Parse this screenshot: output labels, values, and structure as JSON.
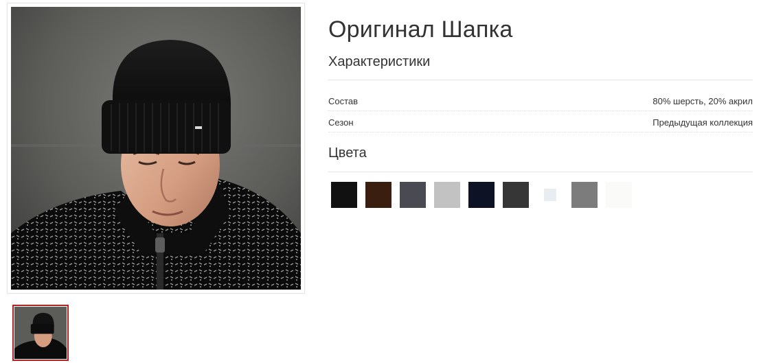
{
  "product": {
    "title": "Оригинал Шапка"
  },
  "characteristics": {
    "heading": "Характеристики",
    "rows": [
      {
        "label": "Состав",
        "value": "80% шерсть, 20% акрил"
      },
      {
        "label": "Сезон",
        "value": "Предыдущая коллекция"
      }
    ]
  },
  "colors": {
    "heading": "Цвета",
    "swatches": [
      {
        "name": "black",
        "color": "#111111"
      },
      {
        "name": "brown",
        "color": "#3a1e10"
      },
      {
        "name": "graphite",
        "color": "#4a4a52"
      },
      {
        "name": "light-gray",
        "color": "#c2c2c2"
      },
      {
        "name": "navy",
        "color": "#0d1224"
      },
      {
        "name": "dark-gray",
        "color": "#363636"
      },
      {
        "name": "white",
        "color": "#e8edf2"
      },
      {
        "name": "gray",
        "color": "#7c7c7c"
      },
      {
        "name": "ivory",
        "color": "#fafaf8"
      }
    ]
  },
  "gallery": {
    "main_image": "man-in-black-beanie-photo",
    "thumbnails": [
      "man-in-black-beanie-thumb"
    ]
  }
}
